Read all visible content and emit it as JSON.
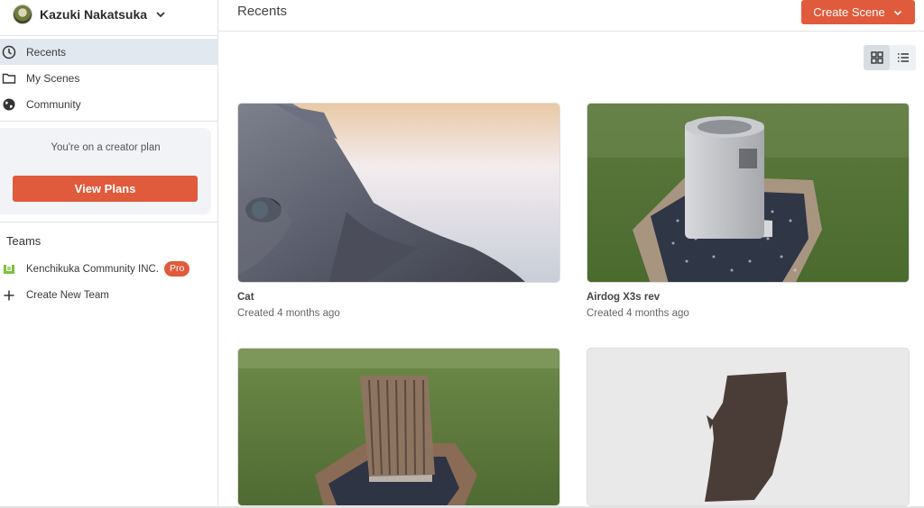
{
  "user": {
    "name": "Kazuki Nakatsuka"
  },
  "nav": {
    "items": [
      {
        "label": "Recents",
        "icon": "clock-icon",
        "active": true
      },
      {
        "label": "My Scenes",
        "icon": "folder-icon",
        "active": false
      },
      {
        "label": "Community",
        "icon": "globe-icon",
        "active": false
      }
    ]
  },
  "plan": {
    "text": "You're on a creator plan",
    "button_label": "View Plans"
  },
  "teams": {
    "heading": "Teams",
    "items": [
      {
        "label": "Kenchikuka Community INC.",
        "badge": "Pro",
        "icon": "team-logo-icon"
      }
    ],
    "create_label": "Create New Team"
  },
  "header": {
    "title": "Recents",
    "create_label": "Create Scene"
  },
  "view_toggle": {
    "active": "grid"
  },
  "scenes": [
    {
      "title": "Cat",
      "meta": "Created 4 months ago"
    },
    {
      "title": "Airdog X3s rev",
      "meta": "Created 4 months ago"
    },
    {
      "title": "",
      "meta": ""
    },
    {
      "title": "",
      "meta": ""
    }
  ],
  "colors": {
    "accent": "#e05a3c",
    "active_nav": "#e2e8f0",
    "panel": "#f1f3f6"
  }
}
